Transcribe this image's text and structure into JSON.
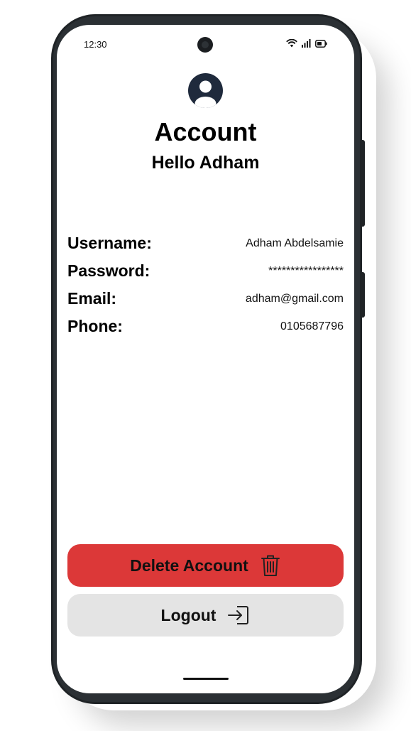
{
  "status_bar": {
    "time": "12:30",
    "icons": [
      "wifi-icon",
      "signal-icon",
      "battery-icon"
    ]
  },
  "header": {
    "avatar_icon": "user-avatar-icon",
    "title": "Account",
    "greeting": "Hello Adham"
  },
  "account_info": [
    {
      "label": "Username:",
      "value": "Adham Abdelsamie"
    },
    {
      "label": "Password:",
      "value": "*****************"
    },
    {
      "label": "Email:",
      "value": "adham@gmail.com"
    },
    {
      "label": "Phone:",
      "value": "0105687796"
    }
  ],
  "actions": {
    "delete": {
      "label": "Delete Account",
      "icon": "trash-icon",
      "color": "#dc3838"
    },
    "logout": {
      "label": "Logout",
      "icon": "logout-icon",
      "color": "#e4e4e4"
    }
  },
  "colors": {
    "avatar": "#1f2a3c",
    "text": "#000000"
  }
}
